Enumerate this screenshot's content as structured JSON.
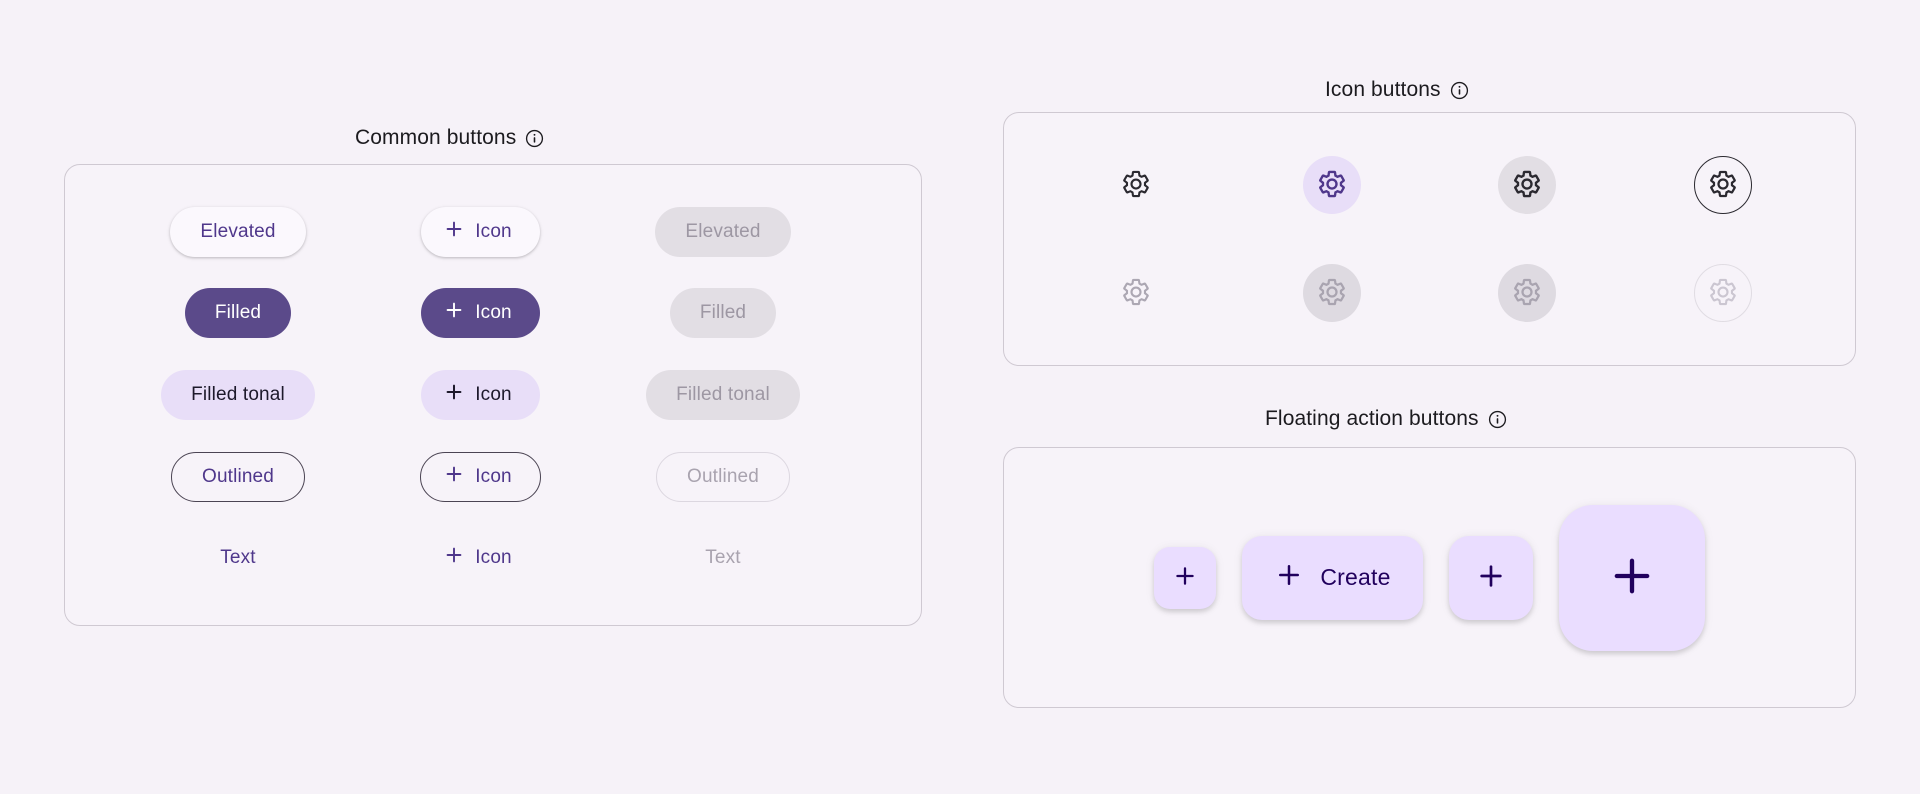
{
  "theme": {
    "background": "#F6F2F8",
    "card_background": "#F7F3F9",
    "card_border": "#CFC9D2",
    "primary": "#5B4A8A",
    "on_primary": "#FFFFFF",
    "primary_text": "#4F378B",
    "tonal_container": "#E8DEF8",
    "on_tonal": "#1D192B",
    "disabled_container": "#E2DEE4",
    "disabled_text": "#9D97A3",
    "fab_container": "#EADDFF",
    "fab_on_container": "#21005D",
    "title_color": "#1C1B1F"
  },
  "sections": {
    "common": {
      "title": "Common buttons",
      "info_icon": "info-circle-icon",
      "rows": [
        {
          "variant": "elevated",
          "enabled_label": "Elevated",
          "icon_label": "Icon",
          "icon_name": "plus-icon",
          "disabled_label": "Elevated"
        },
        {
          "variant": "filled",
          "enabled_label": "Filled",
          "icon_label": "Icon",
          "icon_name": "plus-icon",
          "disabled_label": "Filled"
        },
        {
          "variant": "filled-tonal",
          "enabled_label": "Filled tonal",
          "icon_label": "Icon",
          "icon_name": "plus-icon",
          "disabled_label": "Filled tonal"
        },
        {
          "variant": "outlined",
          "enabled_label": "Outlined",
          "icon_label": "Icon",
          "icon_name": "plus-icon",
          "disabled_label": "Outlined"
        },
        {
          "variant": "text",
          "enabled_label": "Text",
          "icon_label": "Icon",
          "icon_name": "plus-icon",
          "disabled_label": "Text"
        }
      ]
    },
    "icon_buttons": {
      "title": "Icon buttons",
      "info_icon": "info-circle-icon",
      "items": [
        {
          "variant": "standard",
          "icon_name": "gear-icon",
          "state": "enabled"
        },
        {
          "variant": "filled",
          "icon_name": "gear-icon",
          "state": "enabled"
        },
        {
          "variant": "filled-tonal",
          "icon_name": "gear-icon",
          "state": "enabled"
        },
        {
          "variant": "outlined",
          "icon_name": "gear-icon",
          "state": "enabled"
        },
        {
          "variant": "standard",
          "icon_name": "gear-icon",
          "state": "disabled"
        },
        {
          "variant": "filled",
          "icon_name": "gear-icon",
          "state": "disabled"
        },
        {
          "variant": "filled-tonal",
          "icon_name": "gear-icon",
          "state": "disabled"
        },
        {
          "variant": "outlined",
          "icon_name": "gear-icon",
          "state": "disabled"
        }
      ]
    },
    "fabs": {
      "title": "Floating action buttons",
      "info_icon": "info-circle-icon",
      "items": [
        {
          "size": "small",
          "icon_name": "plus-icon",
          "label": ""
        },
        {
          "size": "extended",
          "icon_name": "plus-icon",
          "label": "Create"
        },
        {
          "size": "regular",
          "icon_name": "plus-icon",
          "label": ""
        },
        {
          "size": "large",
          "icon_name": "plus-icon",
          "label": ""
        }
      ]
    }
  }
}
